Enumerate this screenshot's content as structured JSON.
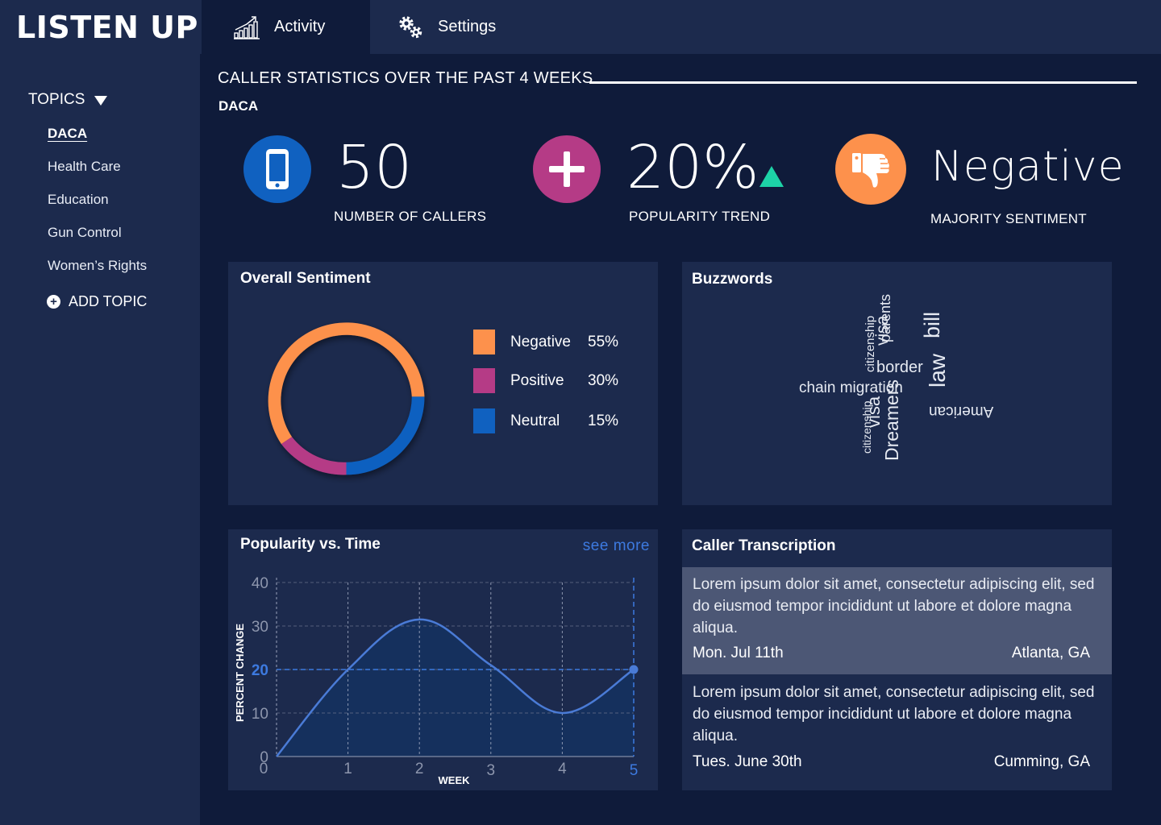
{
  "app": {
    "title": "LISTEN UP"
  },
  "nav": {
    "tabs": [
      {
        "label": "Activity",
        "icon": "activity-chart-icon",
        "active": true
      },
      {
        "label": "Settings",
        "icon": "gears-icon",
        "active": false
      }
    ]
  },
  "sidebar": {
    "topics_header": "TOPICS",
    "topics": [
      {
        "label": "DACA",
        "active": true
      },
      {
        "label": "Health Care",
        "active": false
      },
      {
        "label": "Education",
        "active": false
      },
      {
        "label": "Gun Control",
        "active": false
      },
      {
        "label": "Women’s Rights",
        "active": false
      }
    ],
    "add_topic": "ADD TOPIC"
  },
  "main": {
    "title": "CALLER STATISTICS OVER THE PAST 4 WEEKS",
    "topic": "DACA"
  },
  "kpis": {
    "callers": {
      "value": "50",
      "label": "NUMBER OF CALLERS",
      "icon": "phone-icon",
      "color": "#1061c0"
    },
    "trend": {
      "value": "20%",
      "label": "POPULARITY TREND",
      "icon": "plus-icon",
      "color": "#b53b86",
      "direction_icon": "up-triangle-icon",
      "direction_color": "#1dd3a7"
    },
    "sentiment": {
      "value": "Negative",
      "label": "MAJORITY SENTIMENT",
      "icon": "thumbs-down-icon",
      "color": "#fd914c"
    }
  },
  "overall_sentiment": {
    "title": "Overall Sentiment",
    "legend": [
      {
        "name": "Negative",
        "pct": "55%",
        "color": "#fd914c"
      },
      {
        "name": "Positive",
        "pct": "30%",
        "color": "#b53b86"
      },
      {
        "name": "Neutral",
        "pct": "15%",
        "color": "#1061c0"
      }
    ]
  },
  "buzzwords": {
    "title": "Buzzwords",
    "words": [
      "citizenship",
      "visa",
      "parents",
      "bill",
      "border",
      "chain migration",
      "law",
      "visa",
      "citizenship",
      "Dreamers",
      "American"
    ]
  },
  "popularity": {
    "title": "Popularity vs. Time",
    "see_more": "see more"
  },
  "chart_data": {
    "type": "line",
    "x": [
      0,
      1,
      2,
      3,
      4,
      5
    ],
    "y": [
      0,
      20,
      31.5,
      21,
      10,
      20
    ],
    "xlabel": "WEEK",
    "ylabel": "PERCENT CHANGE",
    "xlim": [
      0,
      5
    ],
    "ylim": [
      0,
      40
    ],
    "yticks": [
      0,
      10,
      20,
      30,
      40
    ],
    "xticks": [
      0,
      1,
      2,
      3,
      4,
      5
    ],
    "highlight": {
      "x": 5,
      "y": 20
    },
    "grid": true,
    "line_color": "#4a7bd6",
    "fill_color": "#15305e"
  },
  "transcription": {
    "title": "Caller Transcription",
    "items": [
      {
        "text": "Lorem ipsum dolor sit amet, consectetur adipiscing elit, sed do eiusmod tempor incididunt ut labore et dolore magna aliqua.",
        "date": "Mon. Jul 11th",
        "location": "Atlanta, GA"
      },
      {
        "text": "Lorem ipsum dolor sit amet, consectetur adipiscing elit, sed do eiusmod tempor incididunt ut labore et dolore magna aliqua.",
        "date": "Tues. June 30th",
        "location": "Cumming, GA"
      }
    ]
  }
}
